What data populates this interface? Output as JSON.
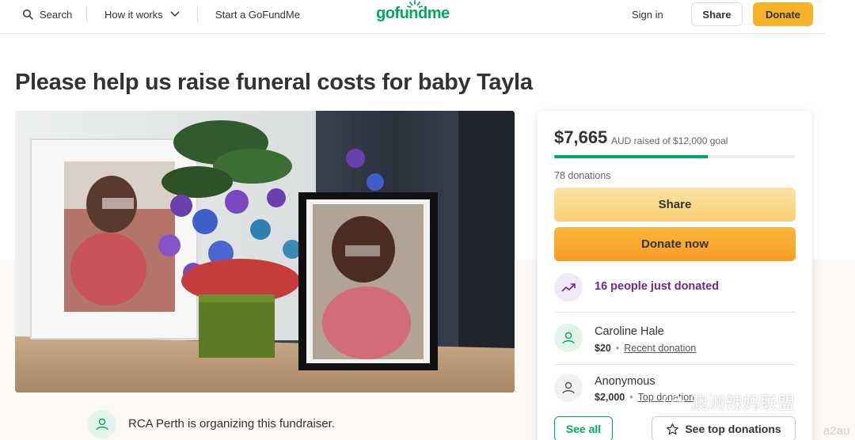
{
  "header": {
    "search_label": "Search",
    "how_it_works_label": "How it works",
    "start_label": "Start a GoFundMe",
    "logo_text": "gofundme",
    "sign_in_label": "Sign in",
    "share_label": "Share",
    "donate_label": "Donate"
  },
  "page": {
    "title": "Please help us raise funeral costs for baby Tayla"
  },
  "organizer": {
    "text": "RCA Perth is organizing this fundraiser."
  },
  "campaign": {
    "raised": "$7,665",
    "raised_suffix": "AUD raised of $12,000 goal",
    "progress_fraction": 0.639,
    "donations_count": "78 donations",
    "share_label": "Share",
    "donate_label": "Donate now",
    "trend_text": "16 people just donated"
  },
  "donations": [
    {
      "name": "Caroline Hale",
      "amount": "$20",
      "tag": "Recent donation"
    },
    {
      "name": "Anonymous",
      "amount": "$2,000",
      "tag": "Top donation"
    }
  ],
  "buttons": {
    "see_all": "See all",
    "see_top": "See top donations"
  },
  "watermark": {
    "text": "澳洲辣妈联盟",
    "extra": "a2au"
  },
  "colors": {
    "brand_green": "#02a95c",
    "donate_orange": "#f5b32a",
    "trend_purple": "#6a2a8c",
    "band_beige": "#fbf8f6"
  }
}
